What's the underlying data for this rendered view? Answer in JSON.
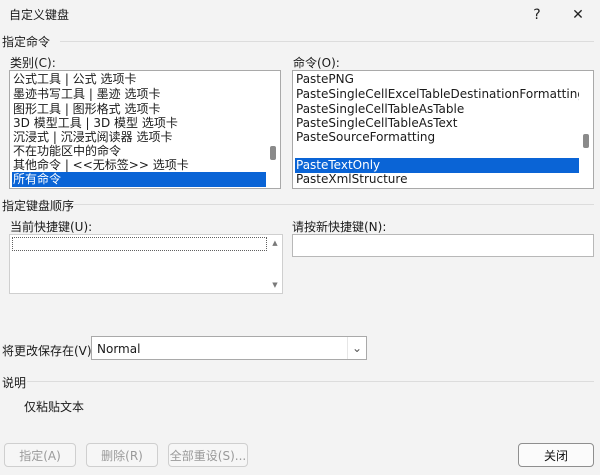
{
  "window": {
    "title": "自定义键盘",
    "help_label": "?",
    "close_label": "✕"
  },
  "sections": {
    "specify_command": "指定命令",
    "specify_sequence": "指定键盘顺序",
    "description": "说明"
  },
  "categories": {
    "label": "类别(C):",
    "items": [
      "公式工具 | 公式 选项卡",
      "墨迹书写工具 | 墨迹 选项卡",
      "图形工具 | 图形格式 选项卡",
      "3D 模型工具 | 3D 模型 选项卡",
      "沉浸式 | 沉浸式阅读器 选项卡",
      "不在功能区中的命令",
      "其他命令 | <<无标签>> 选项卡",
      "所有命令"
    ],
    "selected_index": 7
  },
  "commands": {
    "label": "命令(O):",
    "items": [
      "PastePNG",
      "PasteSingleCellExcelTableDestinationFormatting",
      "PasteSingleCellTableAsTable",
      "PasteSingleCellTableAsText",
      "PasteSourceFormatting",
      "PasteTextOnly",
      "PasteXmlStructure"
    ],
    "selected_index": 5
  },
  "current_keys": {
    "label": "当前快捷键(U):",
    "value": ""
  },
  "new_key": {
    "label": "请按新快捷键(N):",
    "value": ""
  },
  "save_in": {
    "label": "将更改保存在(V):",
    "value": "Normal"
  },
  "description_text": "仅粘贴文本",
  "buttons": {
    "assign": "指定(A)",
    "remove": "删除(R)",
    "reset_all": "全部重设(S)...",
    "close": "关闭"
  },
  "icons": [
    "help-icon",
    "close-icon",
    "scroll-up-arrow-icon",
    "scroll-down-arrow-icon",
    "chevron-down-icon"
  ],
  "colors": {
    "selection": "#0a64d6",
    "background": "#f3f3f3"
  }
}
